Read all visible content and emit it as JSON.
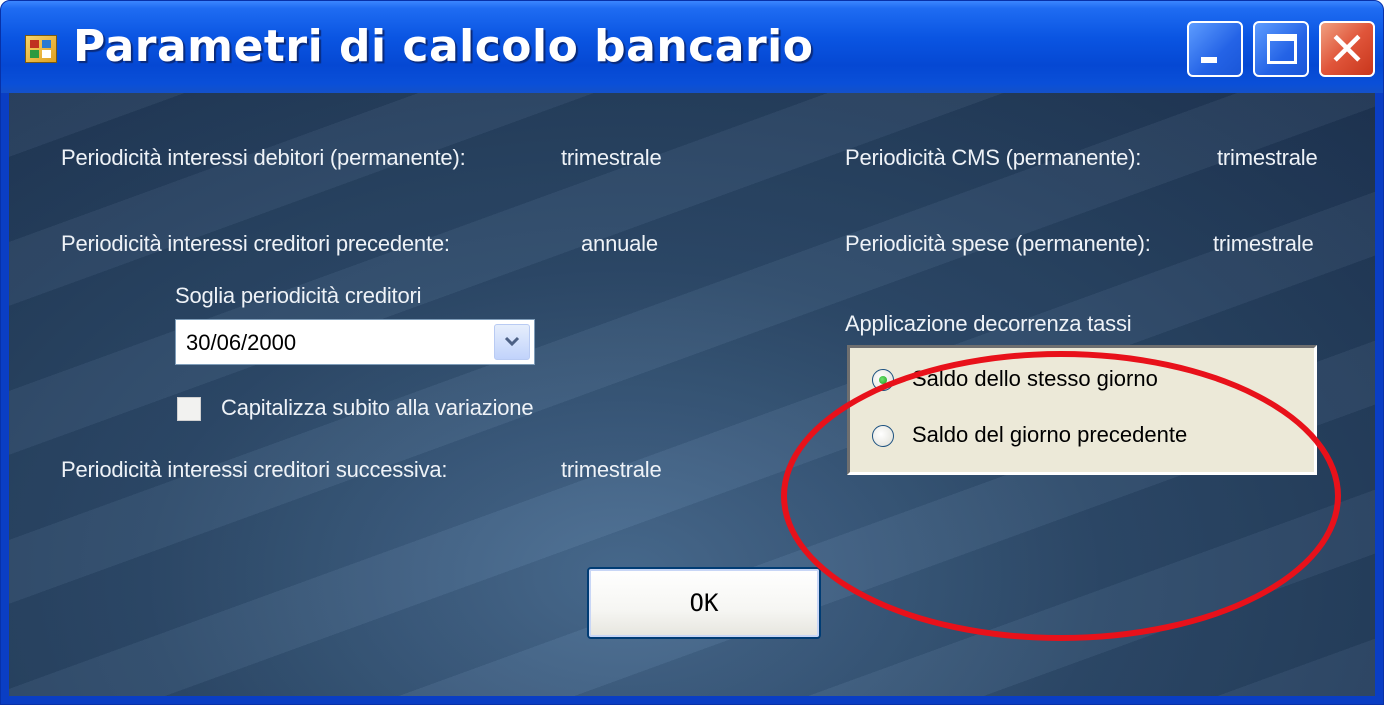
{
  "window": {
    "title": "Parametri di calcolo bancario",
    "title_color": "#ffffff",
    "titlebar_color": "#0a55e2"
  },
  "left": {
    "debitori_label": "Periodicità interessi debitori (permanente):",
    "debitori_value": "trimestrale",
    "creditori_prec_label": "Periodicità interessi creditori precedente:",
    "creditori_prec_value": "annuale",
    "soglia_label": "Soglia periodicità creditori",
    "soglia_value": "30/06/2000",
    "capitalizza_label": "Capitalizza subito alla variazione",
    "capitalizza_checked": false,
    "creditori_succ_label": "Periodicità interessi creditori successiva:",
    "creditori_succ_value": "trimestrale"
  },
  "right": {
    "cms_label": "Periodicità CMS (permanente):",
    "cms_value": "trimestrale",
    "spese_label": "Periodicità spese (permanente):",
    "spese_value": "trimestrale",
    "decorrenza_label": "Applicazione decorrenza tassi",
    "options": [
      {
        "label": "Saldo dello stesso giorno",
        "selected": true
      },
      {
        "label": "Saldo del giorno precedente",
        "selected": false
      }
    ]
  },
  "ok_label": "OK",
  "highlight_color": "#e8111a",
  "icons": {
    "app": "app-icon",
    "minimize": "minimize-icon",
    "maximize": "maximize-icon",
    "close": "close-icon",
    "dropdown": "chevron-down-icon"
  }
}
